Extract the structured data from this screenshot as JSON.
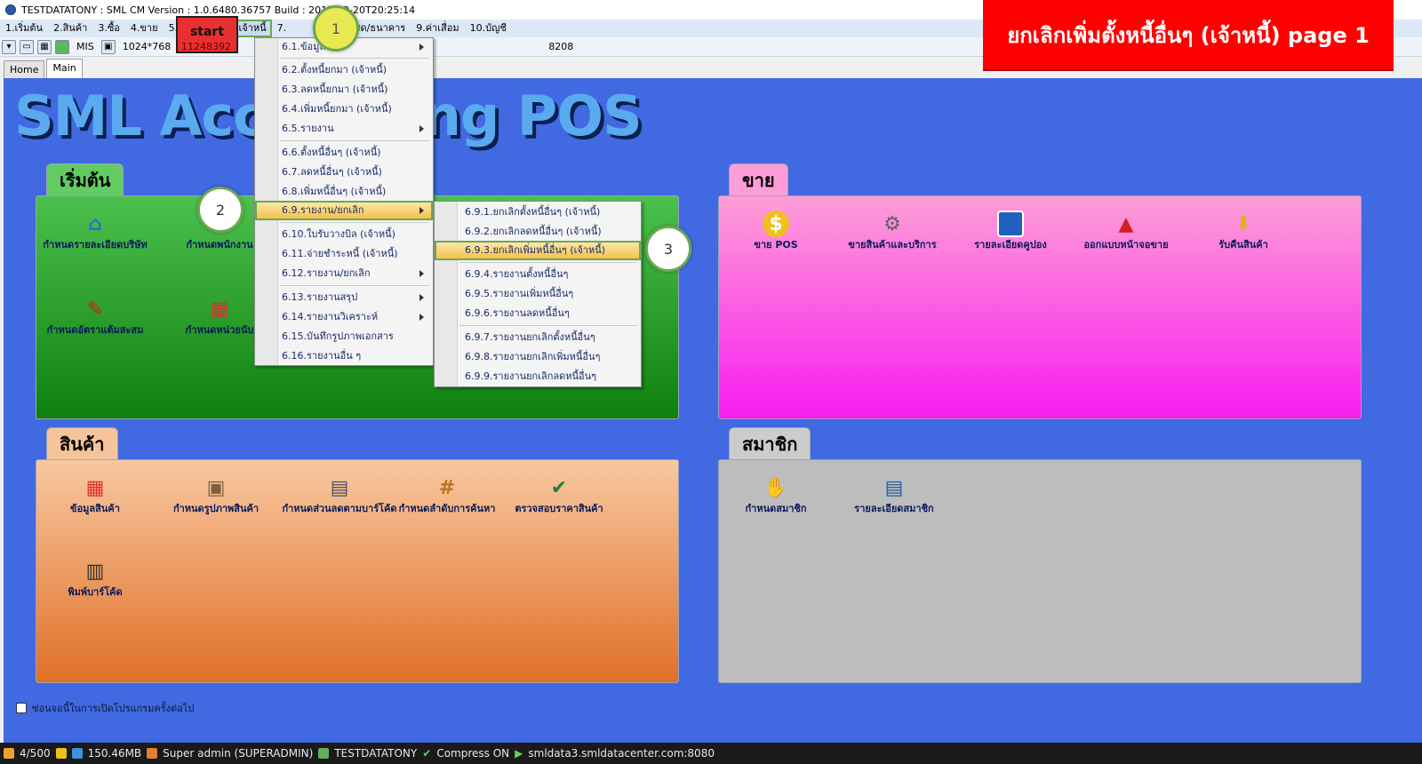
{
  "window": {
    "title": "TESTDATATONY : SML CM Version : 1.0.6480.36757  Build : 2017-09-20T20:25:14"
  },
  "menubar": {
    "items": [
      "1.เริ่มต้น",
      "2.สินค้า",
      "3.ซื้อ",
      "4.ขาย",
      "5.ขาย POS",
      "6.เจ้าหนี้",
      "7.",
      "8.เงินสด/ธนาคาร",
      "9.ค่าเสื่อม",
      "10.บัญชี"
    ]
  },
  "toolbar": {
    "mis_label": "MIS",
    "resolution": "1024*768",
    "code_left": "11248392",
    "code_right": "208",
    "code_far": "8208"
  },
  "tabs": {
    "home": "Home",
    "main": "Main"
  },
  "main": {
    "title": "SML Accounting POS",
    "start_panel": {
      "tab": "เริ่มต้น",
      "tiles": [
        "กำหนดรายละเอียดบริษัท",
        "กำหนดพนักงาน",
        "กำหนดอัตราแต้มสะสม",
        "กำหนดหน่วยนับ"
      ]
    },
    "sale_panel": {
      "tab": "ขาย",
      "tiles": [
        "ขาย POS",
        "ขายสินค้าและบริการ",
        "รายละเอียดคูปอง",
        "ออกแบบหน้าจอขาย",
        "รับคืนสินค้า"
      ]
    },
    "product_panel": {
      "tab": "สินค้า",
      "tiles": [
        "ข้อมูลสินค้า",
        "กำหนดรูปภาพสินค้า",
        "กำหนดส่วนลดตามบาร์โค้ด",
        "กำหนดลำดับการค้นหา",
        "ตรวจสอบราคาสินค้า",
        "พิมพ์บาร์โค้ด"
      ]
    },
    "member_panel": {
      "tab": "สมาชิก",
      "tiles": [
        "กำหนดสมาชิก",
        "รายละเอียดสมาชิก"
      ]
    },
    "footer_checkbox": "ซ่อนจอนี้ในการเปิดโปรแกรมครั้งต่อไป"
  },
  "dropdown_main": {
    "items": [
      "6.1.ข้อมูล",
      "6.2.ตั้งหนี้ยกมา (เจ้าหนี้)",
      "6.3.ลดหนี้ยกมา (เจ้าหนี้)",
      "6.4.เพิ่มหนี้ยกมา (เจ้าหนี้)",
      "6.5.รายงาน",
      "6.6.ตั้งหนี้อื่นๆ (เจ้าหนี้)",
      "6.7.ลดหนี้อื่นๆ (เจ้าหนี้)",
      "6.8.เพิ่มหนี้อื่นๆ (เจ้าหนี้)",
      "6.9.รายงาน/ยกเลิก",
      "6.10.ใบรับวางบิล (เจ้าหนี้)",
      "6.11.จ่ายชำระหนี้ (เจ้าหนี้)",
      "6.12.รายงาน/ยกเลิก",
      "6.13.รายงานสรุป",
      "6.14.รายงานวิเคราะห์",
      "6.15.บันทึกรูปภาพเอกสาร",
      "6.16.รายงานอื่น ๆ"
    ]
  },
  "dropdown_sub": {
    "items": [
      "6.9.1.ยกเลิกตั้งหนี้อื่นๆ (เจ้าหนี้)",
      "6.9.2.ยกเลิกลดหนี้อื่นๆ (เจ้าหนี้)",
      "6.9.3.ยกเลิกเพิ่มหนี้อื่นๆ (เจ้าหนี้)",
      "6.9.4.รายงานตั้งหนี้อื่นๆ",
      "6.9.5.รายงานเพิ่มหนี้อื่นๆ",
      "6.9.6.รายงานลดหนี้อื่นๆ",
      "6.9.7.รายงานยกเลิกตั้งหนี้อื่นๆ",
      "6.9.8.รายงานยกเลิกเพิ่มหนี้อื่นๆ",
      "6.9.9.รายงานยกเลิกลดหนี้อื่นๆ"
    ]
  },
  "annotations": {
    "start_label": "start",
    "start_code": "11248392",
    "step1": "1",
    "step2": "2",
    "step3": "3",
    "banner": "ยกเลิกเพิ่มตั้งหนี้อื่นๆ (เจ้าหนี้)  page 1"
  },
  "statusbar": {
    "connections": "4/500",
    "memory": "150.46MB",
    "user": "Super admin (SUPERADMIN)",
    "database": "TESTDATATONY",
    "compress": "Compress ON",
    "server": "smldata3.smldatacenter.com:8080"
  },
  "colors": {
    "main_bg": "#4169e1",
    "start_panel": "#1fa01f",
    "sale_panel": "#f81cf0",
    "product_panel": "#e07028",
    "member_panel": "#bdbdbd",
    "highlight_border": "#6aa84f",
    "banner": "#fe0000"
  }
}
